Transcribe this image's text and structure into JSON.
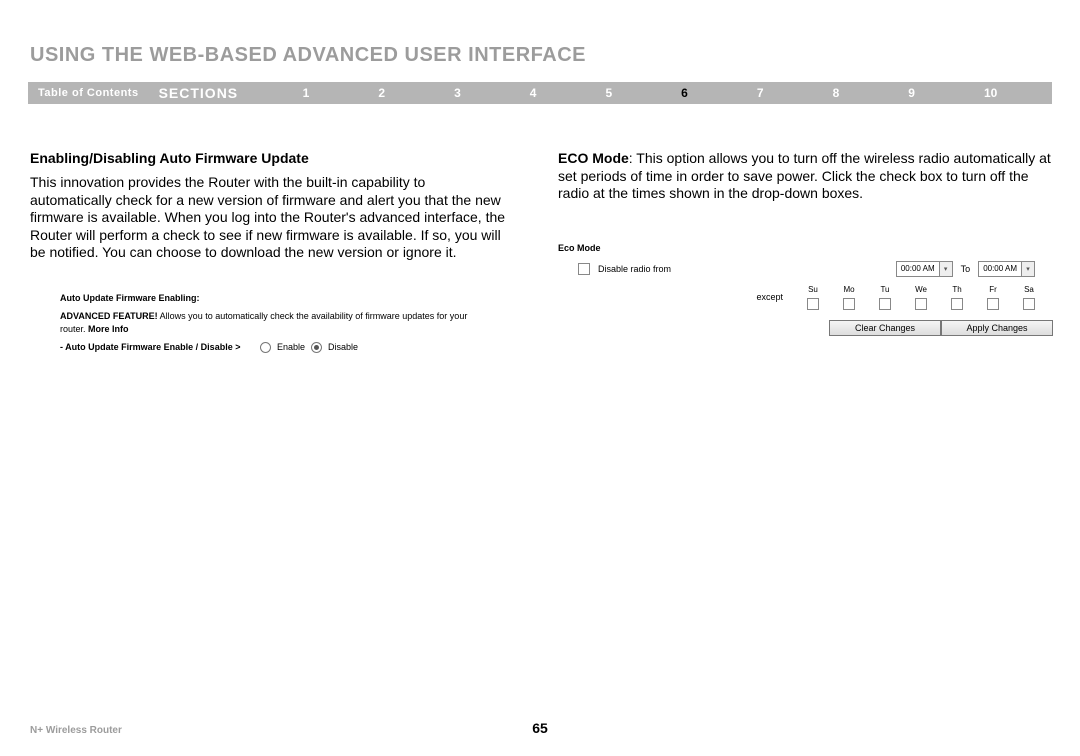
{
  "page_title": "USING THE WEB-BASED ADVANCED USER INTERFACE",
  "navbar": {
    "toc": "Table of Contents",
    "sections": "SECTIONS",
    "items": [
      "1",
      "2",
      "3",
      "4",
      "5",
      "6",
      "7",
      "8",
      "9",
      "10"
    ],
    "active_index": 5
  },
  "left": {
    "subheading": "Enabling/Disabling Auto Firmware Update",
    "body": "This innovation provides the Router with the built-in capability to automatically check for a new version of firmware and alert you that the new firmware is available. When you log into the Router's advanced interface, the Router will perform a check to see if new firmware is available. If so, you will be notified. You can choose to download the new version or ignore it.",
    "panel": {
      "header": "Auto Update Firmware Enabling:",
      "desc_prefix": "ADVANCED FEATURE!",
      "desc": " Allows you to automatically check the availability of firmware updates for your router. ",
      "more_info": "More Info",
      "row_label": "- Auto Update Firmware Enable / Disable >",
      "enable": "Enable",
      "disable": "Disable"
    }
  },
  "right": {
    "eco_label": "ECO Mode",
    "body": ": This option allows you to turn off the wireless radio automatically at set periods of time in order to save power. Click the check box to turn off the radio at the times shown in the drop-down boxes.",
    "eco_panel": {
      "header": "Eco Mode",
      "disable_radio": "Disable radio from",
      "time1": "00:00 AM",
      "to": "To",
      "time2": "00:00 AM",
      "except": "except",
      "days": [
        "Su",
        "Mo",
        "Tu",
        "We",
        "Th",
        "Fr",
        "Sa"
      ],
      "clear": "Clear Changes",
      "apply": "Apply Changes"
    }
  },
  "footer": {
    "product": "N+ Wireless Router",
    "page_number": "65"
  }
}
